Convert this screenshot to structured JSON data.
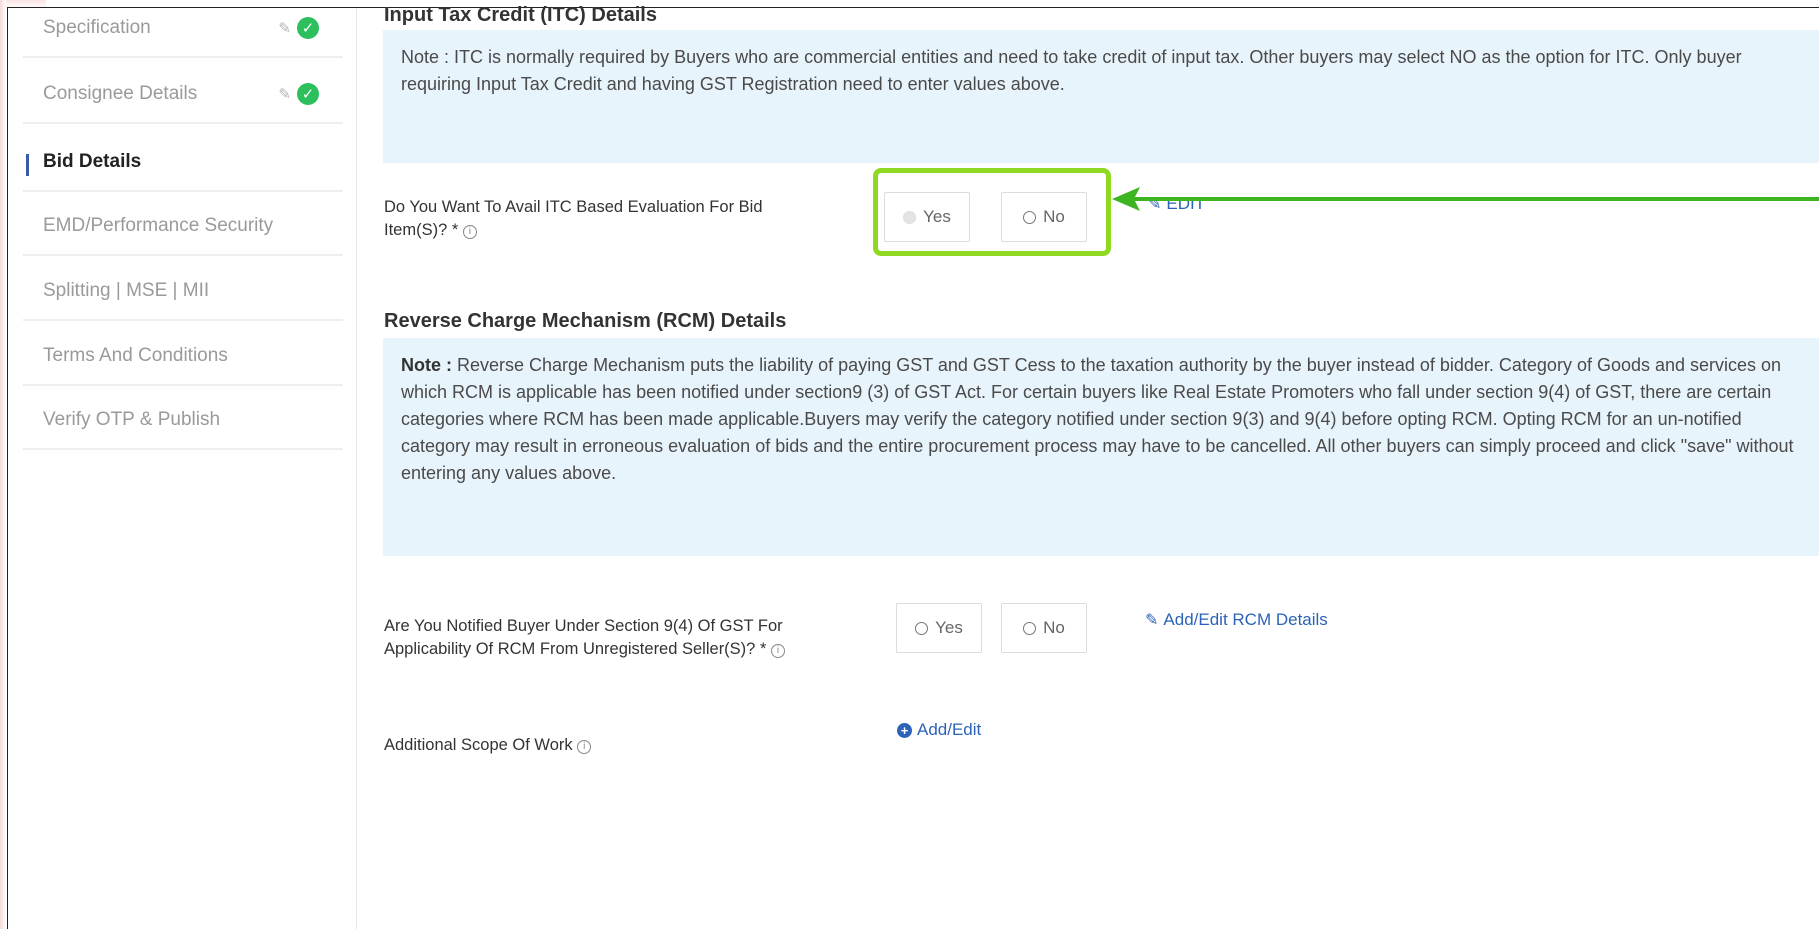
{
  "sidebar": {
    "items": [
      {
        "label": "Specification",
        "status": "complete"
      },
      {
        "label": "Consignee Details",
        "status": "complete"
      },
      {
        "label": "Bid Details",
        "status": "active"
      },
      {
        "label": "EMD/Performance Security",
        "status": "none"
      },
      {
        "label": "Splitting | MSE | MII",
        "status": "none"
      },
      {
        "label": "Terms And Conditions",
        "status": "none"
      },
      {
        "label": "Verify OTP & Publish",
        "status": "none"
      }
    ]
  },
  "itc": {
    "title": "Input Tax Credit (ITC) Details",
    "note": "Note : ITC is normally required by Buyers who are commercial entities and need to take credit of input tax. Other buyers may select NO as the option for ITC. Only buyer requiring Input Tax Credit and having GST Registration need to enter values above.",
    "question_line1": "Do You Want To Avail ITC Based Evaluation For Bid",
    "question_line2": "Item(S)? *",
    "yes_label": "Yes",
    "no_label": "No",
    "edit_label": "EDIT"
  },
  "rcm": {
    "title": "Reverse Charge Mechanism (RCM) Details",
    "note_prefix": "Note :",
    "note": " Reverse Charge Mechanism puts the liability of paying GST and GST Cess to the taxation authority by the buyer instead of bidder. Category of Goods and services on which RCM is applicable has been notified under section9 (3) of GST Act. For certain buyers like Real Estate Promoters who fall under section 9(4) of GST, there are certain categories where RCM has been made applicable.Buyers may verify the category notified under section 9(3) and 9(4) before opting RCM. Opting RCM for an un-notified category may result in erroneous evaluation of bids and the entire procurement process may have to be cancelled. All other buyers can simply proceed and click \"save\" without entering any values above.",
    "question_line1": "Are You Notified Buyer Under Section 9(4) Of GST For",
    "question_line2": "Applicability Of RCM From Unregistered Seller(S)? *",
    "yes_label": "Yes",
    "no_label": "No",
    "edit_label": "Add/Edit RCM Details"
  },
  "scope": {
    "label": "Additional Scope Of Work",
    "link_label": "Add/Edit"
  },
  "colors": {
    "highlight": "#8fd820",
    "link": "#2c63b8",
    "check": "#2dbf5c",
    "note_bg": "#e8f4fb"
  }
}
